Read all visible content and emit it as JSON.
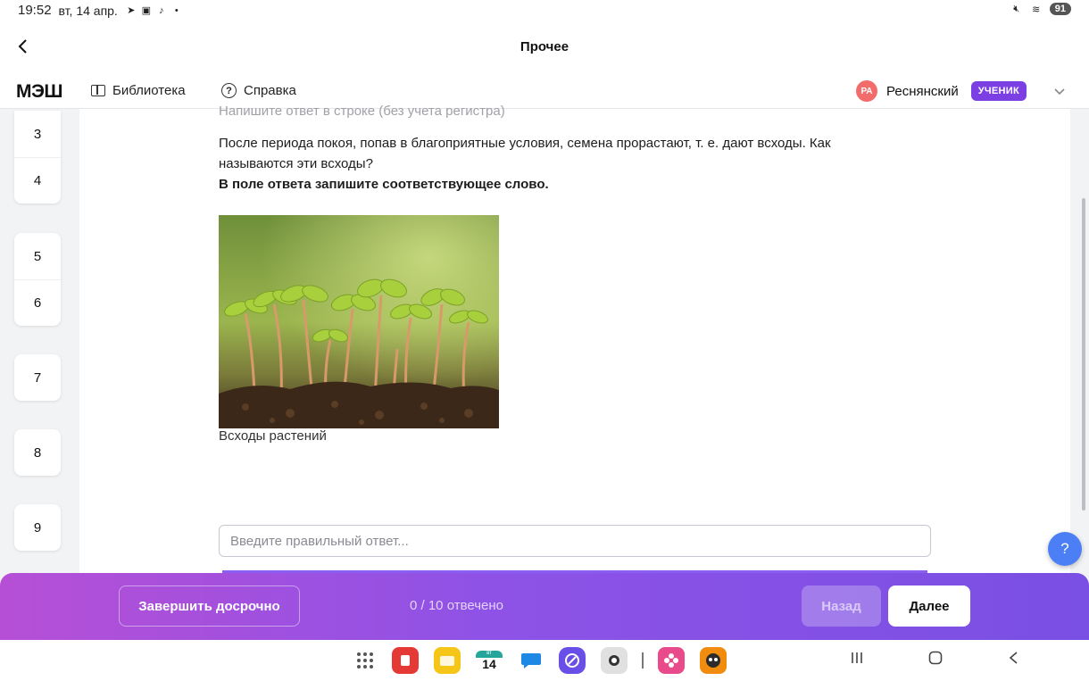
{
  "status_bar": {
    "time": "19:52",
    "date": "вт, 14 апр.",
    "battery": "91",
    "icons": [
      "telegram-icon",
      "app-icon",
      "tiktok-icon",
      "dot-icon",
      "mute-icon",
      "wifi-icon",
      "battery-icon"
    ]
  },
  "titlebar": {
    "title": "Прочее"
  },
  "header": {
    "logo": "МЭШ",
    "nav": [
      {
        "label": "Библиотека",
        "icon": "book-icon"
      },
      {
        "label": "Справка",
        "icon": "help-circle-icon"
      }
    ],
    "user": {
      "initials": "РА",
      "name": "Реснянский",
      "role": "УЧЕНИК"
    }
  },
  "question_nav": [
    {
      "items": [
        "3",
        "4"
      ]
    },
    {
      "items": [
        "5",
        "6"
      ]
    },
    {
      "items": [
        "7"
      ]
    },
    {
      "items": [
        "8"
      ]
    },
    {
      "items": [
        "9"
      ]
    }
  ],
  "main": {
    "hint": "Напишите ответ в строке (без учета регистра)",
    "question": "После периода покоя, попав в благоприятные условия, семена прорастают, т. е. дают всходы. Как называются эти всходы?",
    "instruction": "В поле ответа запишите соответствующее слово.",
    "image_caption": "Всходы растений",
    "answer_placeholder": "Введите правильный ответ...",
    "answer_value": ""
  },
  "help_fab": "?",
  "action_bar": {
    "finish_label": "Завершить досрочно",
    "progress_text": "0 / 10 отвечено",
    "answered": 0,
    "total": 10,
    "prev_label": "Назад",
    "next_label": "Далее"
  },
  "dock": {
    "calendar_day": "14",
    "calendar_weekday": "вт",
    "apps": [
      "apps-grid-icon",
      "notes-app-icon",
      "files-app-icon",
      "calendar-app-icon",
      "messages-app-icon",
      "browser-app-icon",
      "camera-app-icon",
      "gallery-app-icon",
      "game-app-icon"
    ]
  },
  "colors": {
    "accent": "#7b3fe4",
    "action_bar_start": "#b64fd6",
    "action_bar_end": "#7a4fe4",
    "help_fab": "#4c7ef5",
    "avatar": "#f36c6c"
  }
}
